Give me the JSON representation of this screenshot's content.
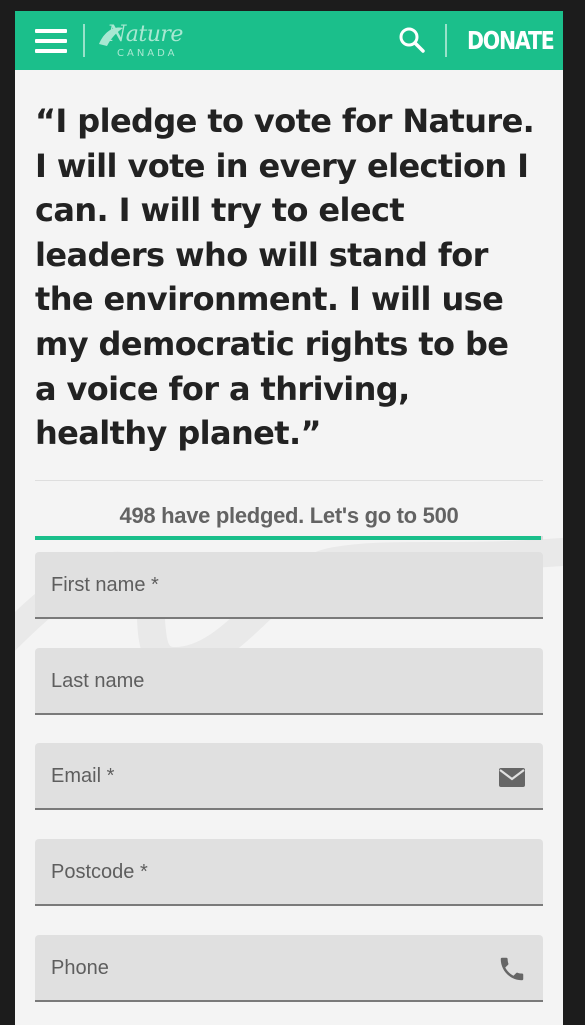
{
  "header": {
    "logo_main": "Nature",
    "logo_sub": "CANADA",
    "donate_label": "DONATE",
    "menu_icon": "hamburger-menu-icon",
    "search_icon": "search-icon",
    "brand_color": "#1bbf8b"
  },
  "pledge": {
    "text": "“I pledge to vote for Nature. I will vote in every election I can. I will try to elect leaders who will stand for the environment. I will use my democratic rights to be a voice for a thriving, healthy planet.”"
  },
  "progress": {
    "label": "498 have pledged. Let's go to 500",
    "current": 498,
    "goal": 500
  },
  "form": {
    "fields": [
      {
        "label": "First name *",
        "placeholder": "First name *",
        "icon": null
      },
      {
        "label": "Last name",
        "placeholder": "Last name",
        "icon": null
      },
      {
        "label": "Email *",
        "placeholder": "Email *",
        "icon": "mail-icon"
      },
      {
        "label": "Postcode *",
        "placeholder": "Postcode *",
        "icon": null
      },
      {
        "label": "Phone",
        "placeholder": "Phone",
        "icon": "phone-icon"
      }
    ]
  }
}
